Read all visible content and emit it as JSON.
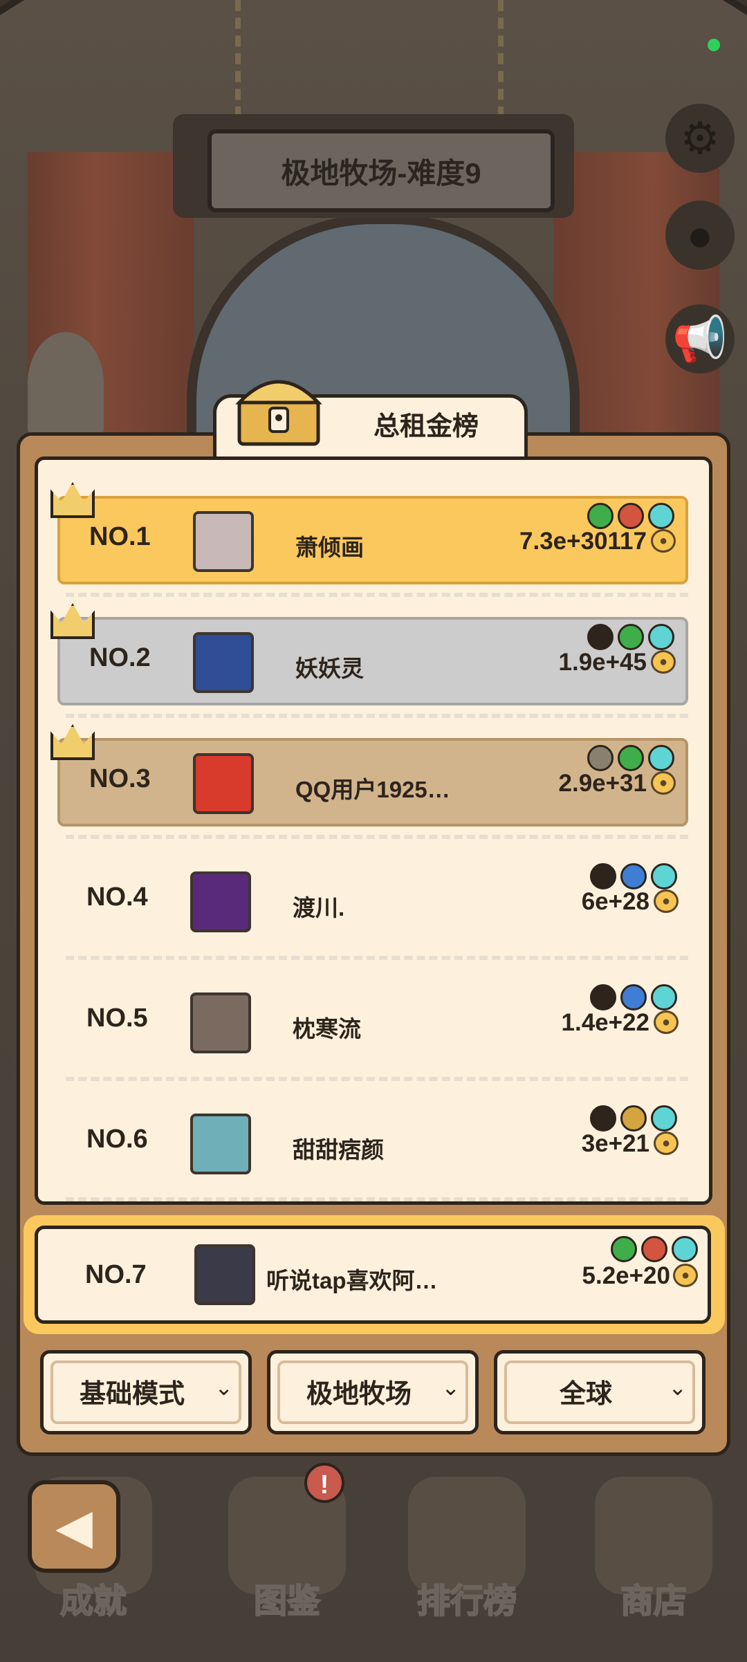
{
  "header": {
    "title": "极地牧场-难度9"
  },
  "board": {
    "title": "总租金榜"
  },
  "rows": [
    {
      "rank": "NO.1",
      "name": "萧倾画",
      "score": "7.3e+30117",
      "badges": [
        "#3fae4a",
        "#d4553f",
        "#5fd4d4"
      ],
      "avatar_color": "#c9b8b8"
    },
    {
      "rank": "NO.2",
      "name": "妖妖灵",
      "score": "1.9e+45",
      "badges": [
        "#2d241c",
        "#3fae4a",
        "#5fd4d4"
      ],
      "avatar_color": "#2f4e96"
    },
    {
      "rank": "NO.3",
      "name": "QQ用户1925…",
      "score": "2.9e+31",
      "badges": [
        "#8a8070",
        "#3fae4a",
        "#5fd4d4"
      ],
      "avatar_color": "#d83a2c"
    },
    {
      "rank": "NO.4",
      "name": "渡川.",
      "score": "6e+28",
      "badges": [
        "#2d241c",
        "#3f7ed4",
        "#5fd4d4"
      ],
      "avatar_color": "#5a2a7a"
    },
    {
      "rank": "NO.5",
      "name": "枕寒流",
      "score": "1.4e+22",
      "badges": [
        "#2d241c",
        "#3f7ed4",
        "#5fd4d4"
      ],
      "avatar_color": "#7a6a60"
    },
    {
      "rank": "NO.6",
      "name": "甜甜痞颜",
      "score": "3e+21",
      "badges": [
        "#2d241c",
        "#d4a43f",
        "#5fd4d4"
      ],
      "avatar_color": "#6fb0b8"
    }
  ],
  "self": {
    "rank": "NO.7",
    "name": "听说tap喜欢阿…",
    "score": "5.2e+20",
    "badges": [
      "#3fae4a",
      "#d4553f",
      "#5fd4d4"
    ],
    "avatar_color": "#3a3a48"
  },
  "filters": [
    {
      "label": "基础模式"
    },
    {
      "label": "极地牧场"
    },
    {
      "label": "全球"
    }
  ],
  "nav": [
    {
      "label": "成就"
    },
    {
      "label": "图鉴",
      "badge": "!"
    },
    {
      "label": "排行榜"
    },
    {
      "label": "商店"
    }
  ],
  "icons": {
    "settings": "gear-icon",
    "qq": "penguin-icon",
    "notice": "megaphone-icon",
    "back": "back-arrow-icon",
    "currency": "paw-coin-icon"
  }
}
